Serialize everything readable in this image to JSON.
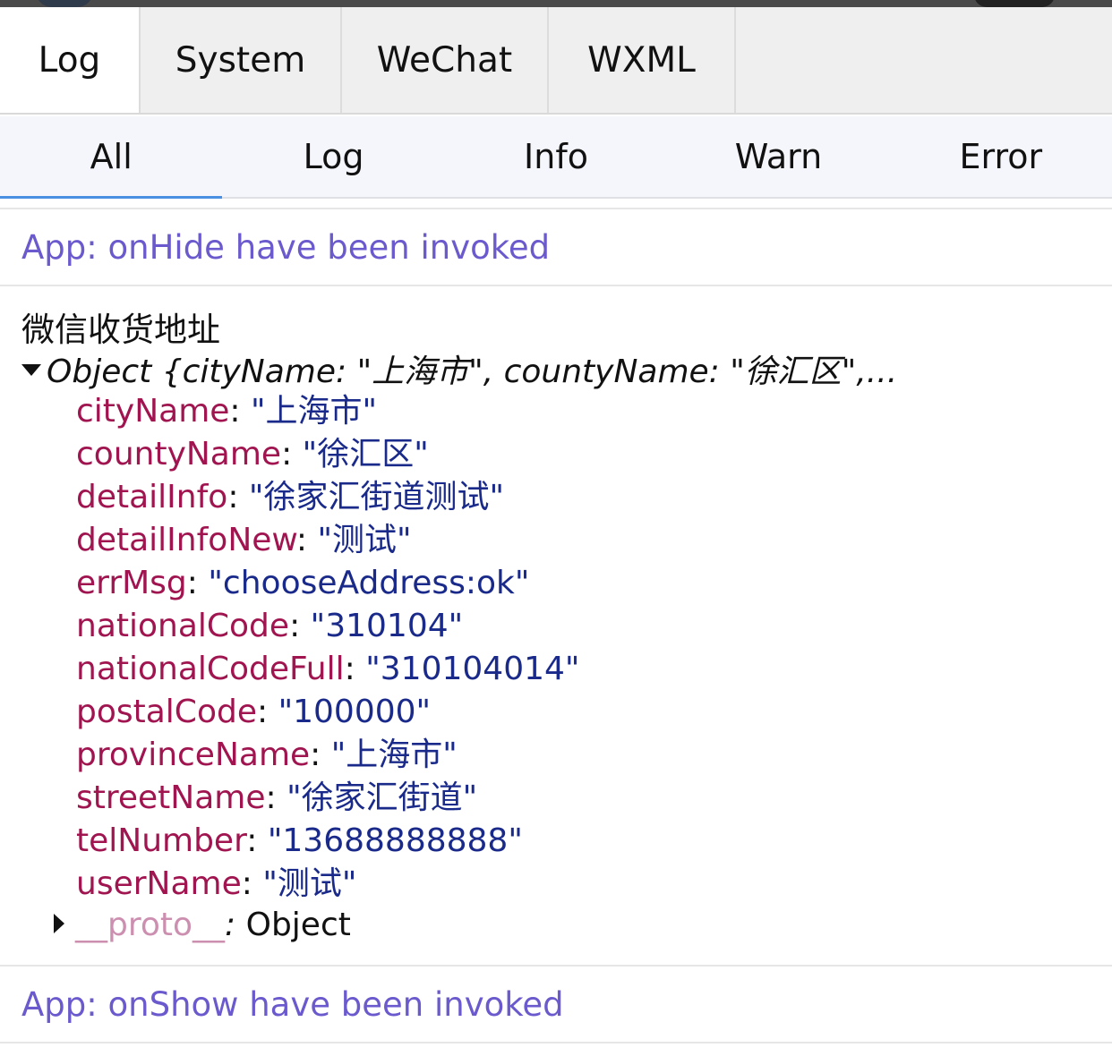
{
  "main_tabs": [
    {
      "label": "Log",
      "active": true
    },
    {
      "label": "System",
      "active": false
    },
    {
      "label": "WeChat",
      "active": false
    },
    {
      "label": "WXML",
      "active": false
    }
  ],
  "filter_tabs": [
    {
      "label": "All",
      "active": true
    },
    {
      "label": "Log",
      "active": false
    },
    {
      "label": "Info",
      "active": false
    },
    {
      "label": "Warn",
      "active": false
    },
    {
      "label": "Error",
      "active": false
    }
  ],
  "logs": {
    "on_hide": "App: onHide have been invoked",
    "object_entry": {
      "title": "微信收货地址",
      "summary": "Object {cityName: \"上海市\", countyName: \"徐汇区\",...",
      "props": [
        {
          "key": "cityName",
          "value": "\"上海市\""
        },
        {
          "key": "countyName",
          "value": "\"徐汇区\""
        },
        {
          "key": "detailInfo",
          "value": "\"徐家汇街道测试\""
        },
        {
          "key": "detailInfoNew",
          "value": "\"测试\""
        },
        {
          "key": "errMsg",
          "value": "\"chooseAddress:ok\""
        },
        {
          "key": "nationalCode",
          "value": "\"310104\""
        },
        {
          "key": "nationalCodeFull",
          "value": "\"310104014\""
        },
        {
          "key": "postalCode",
          "value": "\"100000\""
        },
        {
          "key": "provinceName",
          "value": "\"上海市\""
        },
        {
          "key": "streetName",
          "value": "\"徐家汇街道\""
        },
        {
          "key": "telNumber",
          "value": "\"13688888888\""
        },
        {
          "key": "userName",
          "value": "\"测试\""
        }
      ],
      "proto_key": "__proto__",
      "proto_sep": ": ",
      "proto_value": "Object"
    },
    "on_show": "App: onShow have been invoked"
  },
  "separator": ": ",
  "colors": {
    "system_log": "#6a5acd",
    "prop_key": "#a0144f",
    "prop_value": "#1a2a8a",
    "proto_key": "#cc8fb0",
    "active_underline": "#4a90e2"
  }
}
